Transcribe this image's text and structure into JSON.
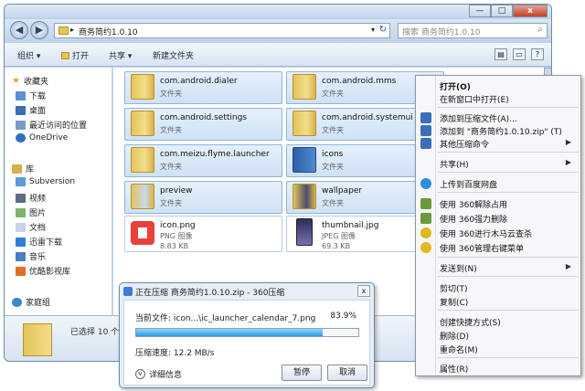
{
  "window": {
    "address": "商务简约1.0.10",
    "search_placeholder": "搜索 商务简约1.0.10",
    "controls": {
      "minimize": "—",
      "maximize": "□",
      "close": "x"
    }
  },
  "toolbar": {
    "organize": "组织 ▾",
    "open": "打开",
    "share": "共享 ▾",
    "new_folder": "新建文件夹"
  },
  "nav": {
    "favorites": "收藏夹",
    "items": [
      "下载",
      "桌面",
      "最近访问的位置",
      "OneDrive"
    ],
    "libraries": "库",
    "lib_items": [
      "Subversion",
      "视频",
      "图片",
      "文档",
      "迅雷下载",
      "音乐",
      "优酷影视库"
    ],
    "homegroup": "家庭组"
  },
  "files": [
    {
      "name": "com.android.dialer",
      "type": "文件夹",
      "size": ""
    },
    {
      "name": "com.android.mms",
      "type": "文件夹",
      "size": ""
    },
    {
      "name": "com.android.settings",
      "type": "文件夹",
      "size": ""
    },
    {
      "name": "com.android.systemui",
      "type": "文件夹",
      "size": ""
    },
    {
      "name": "com.meizu.flyme.launcher",
      "type": "文件夹",
      "size": ""
    },
    {
      "name": "icons",
      "type": "文件夹",
      "size": ""
    },
    {
      "name": "preview",
      "type": "文件夹",
      "size": ""
    },
    {
      "name": "wallpaper",
      "type": "文件夹",
      "size": ""
    },
    {
      "name": "icon.png",
      "type": "PNG 图像",
      "size": "8.83 KB"
    },
    {
      "name": "thumbnail.jpg",
      "type": "JPEG 图像",
      "size": "69.3 KB"
    }
  ],
  "details": {
    "selected": "已选择 10 个"
  },
  "context_menu": {
    "items": [
      "打开(O)",
      "在新窗口中打开(E)",
      "添加到压缩文件(A)...",
      "添加到 \"商务简约1.0.10.zip\" (T)",
      "其他压缩命令",
      "共享(H)",
      "上传到百度网盘",
      "使用 360解除占用",
      "使用 360强力删除",
      "使用 360进行木马云查杀",
      "使用 360管理右键菜单",
      "发送到(N)",
      "剪切(T)",
      "复制(C)",
      "创建快捷方式(S)",
      "删除(D)",
      "重命名(M)",
      "属性(R)"
    ]
  },
  "dialog": {
    "title": "正在压缩 商务简约1.0.10.zip - 360压缩",
    "current_file": "当前文件: icon...\\ic_launcher_calendar_7.png",
    "percent": "83.9%",
    "progress": 0.839,
    "speed": "压缩速度: 12.2 MB/s",
    "details": "详细信息",
    "pause": "暂停",
    "cancel": "取消",
    "close": "x"
  },
  "colors": {
    "accent": "#3b7dd8",
    "tile_bg": "#d6e8fa",
    "progress": "#2a9ae0"
  }
}
